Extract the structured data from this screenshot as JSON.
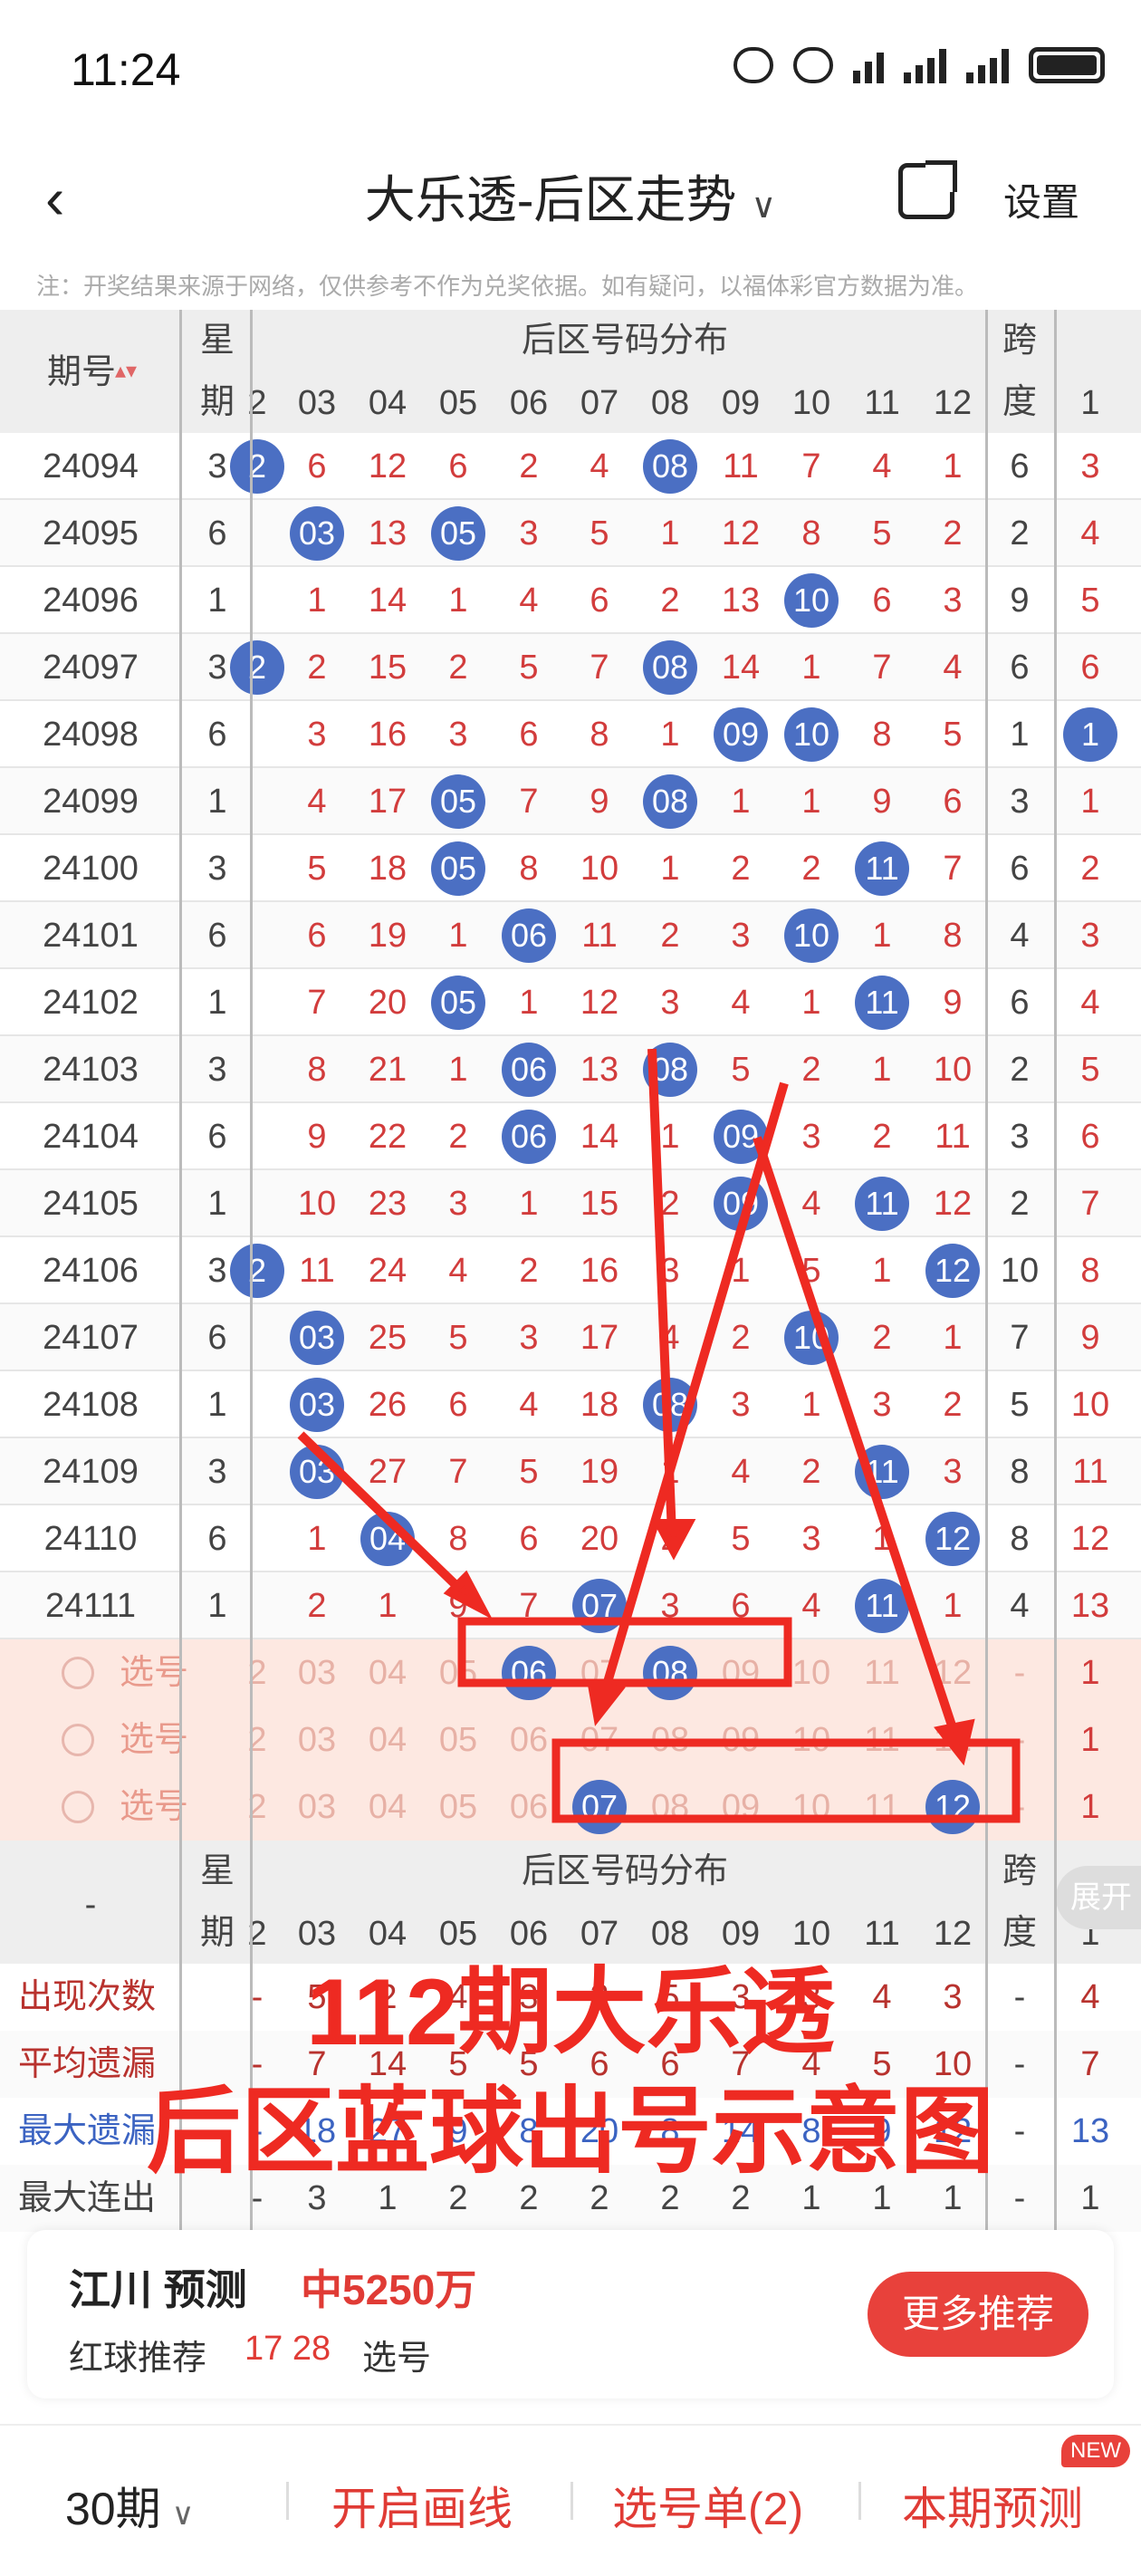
{
  "status": {
    "time": "11:24"
  },
  "header": {
    "title": "大乐透-后区走势",
    "settings": "设置"
  },
  "note": "注：开奖结果来源于网络，仅供参考不作为兑奖依据。如有疑问，以福体彩官方数据为准。",
  "table": {
    "header_issue": "期号",
    "header_week": [
      "星",
      "期"
    ],
    "header_dist": "后区号码分布",
    "header_span": [
      "跨",
      "度"
    ],
    "columns": [
      "2",
      "03",
      "04",
      "05",
      "06",
      "07",
      "08",
      "09",
      "10",
      "11",
      "12"
    ],
    "extra_col": "1",
    "rows": [
      {
        "issue": "24094",
        "week": "3",
        "cells": [
          "2",
          "6",
          "12",
          "6",
          "2",
          "4",
          "08",
          "11",
          "7",
          "4",
          "1"
        ],
        "balls": [
          0,
          6
        ],
        "span": "6",
        "extra": "3"
      },
      {
        "issue": "24095",
        "week": "6",
        "cells": [
          "",
          "03",
          "13",
          "05",
          "3",
          "5",
          "1",
          "12",
          "8",
          "5",
          "2"
        ],
        "balls": [
          1,
          3
        ],
        "span": "2",
        "extra": "4"
      },
      {
        "issue": "24096",
        "week": "1",
        "cells": [
          "",
          "1",
          "14",
          "1",
          "4",
          "6",
          "2",
          "13",
          "10",
          "6",
          "3"
        ],
        "balls": [
          8
        ],
        "span": "9",
        "extra": "5"
      },
      {
        "issue": "24097",
        "week": "3",
        "cells": [
          "2",
          "2",
          "15",
          "2",
          "5",
          "7",
          "08",
          "14",
          "1",
          "7",
          "4"
        ],
        "balls": [
          0,
          6
        ],
        "span": "6",
        "extra": "6"
      },
      {
        "issue": "24098",
        "week": "6",
        "cells": [
          "",
          "3",
          "16",
          "3",
          "6",
          "8",
          "1",
          "09",
          "10",
          "8",
          "5"
        ],
        "balls": [
          7,
          8
        ],
        "span": "1",
        "extra": "1",
        "extra_ball": true
      },
      {
        "issue": "24099",
        "week": "1",
        "cells": [
          "",
          "4",
          "17",
          "05",
          "7",
          "9",
          "08",
          "1",
          "1",
          "9",
          "6"
        ],
        "balls": [
          3,
          6
        ],
        "span": "3",
        "extra": "1"
      },
      {
        "issue": "24100",
        "week": "3",
        "cells": [
          "",
          "5",
          "18",
          "05",
          "8",
          "10",
          "1",
          "2",
          "2",
          "11",
          "7"
        ],
        "balls": [
          3,
          9
        ],
        "span": "6",
        "extra": "2"
      },
      {
        "issue": "24101",
        "week": "6",
        "cells": [
          "",
          "6",
          "19",
          "1",
          "06",
          "11",
          "2",
          "3",
          "10",
          "1",
          "8"
        ],
        "balls": [
          4,
          8
        ],
        "span": "4",
        "extra": "3"
      },
      {
        "issue": "24102",
        "week": "1",
        "cells": [
          "",
          "7",
          "20",
          "05",
          "1",
          "12",
          "3",
          "4",
          "1",
          "11",
          "9"
        ],
        "balls": [
          3,
          9
        ],
        "span": "6",
        "extra": "4"
      },
      {
        "issue": "24103",
        "week": "3",
        "cells": [
          "",
          "8",
          "21",
          "1",
          "06",
          "13",
          "08",
          "5",
          "2",
          "1",
          "10"
        ],
        "balls": [
          4,
          6
        ],
        "span": "2",
        "extra": "5"
      },
      {
        "issue": "24104",
        "week": "6",
        "cells": [
          "",
          "9",
          "22",
          "2",
          "06",
          "14",
          "1",
          "09",
          "3",
          "2",
          "11"
        ],
        "balls": [
          4,
          7
        ],
        "span": "3",
        "extra": "6"
      },
      {
        "issue": "24105",
        "week": "1",
        "cells": [
          "",
          "10",
          "23",
          "3",
          "1",
          "15",
          "2",
          "09",
          "4",
          "11",
          "12"
        ],
        "balls": [
          7,
          9
        ],
        "span": "2",
        "extra": "7"
      },
      {
        "issue": "24106",
        "week": "3",
        "cells": [
          "2",
          "11",
          "24",
          "4",
          "2",
          "16",
          "3",
          "1",
          "5",
          "1",
          "12"
        ],
        "balls": [
          0,
          10
        ],
        "span": "10",
        "extra": "8"
      },
      {
        "issue": "24107",
        "week": "6",
        "cells": [
          "",
          "03",
          "25",
          "5",
          "3",
          "17",
          "4",
          "2",
          "10",
          "2",
          "1"
        ],
        "balls": [
          1,
          8
        ],
        "span": "7",
        "extra": "9"
      },
      {
        "issue": "24108",
        "week": "1",
        "cells": [
          "",
          "03",
          "26",
          "6",
          "4",
          "18",
          "08",
          "3",
          "1",
          "3",
          "2"
        ],
        "balls": [
          1,
          6
        ],
        "span": "5",
        "extra": "10"
      },
      {
        "issue": "24109",
        "week": "3",
        "cells": [
          "",
          "03",
          "27",
          "7",
          "5",
          "19",
          "1",
          "4",
          "2",
          "11",
          "3"
        ],
        "balls": [
          1,
          9
        ],
        "span": "8",
        "extra": "11"
      },
      {
        "issue": "24110",
        "week": "6",
        "cells": [
          "",
          "1",
          "04",
          "8",
          "6",
          "20",
          "2",
          "5",
          "3",
          "1",
          "12"
        ],
        "balls": [
          2,
          10
        ],
        "span": "8",
        "extra": "12"
      },
      {
        "issue": "24111",
        "week": "1",
        "cells": [
          "",
          "2",
          "1",
          "9",
          "7",
          "07",
          "3",
          "6",
          "4",
          "11",
          "1"
        ],
        "balls": [
          5,
          9
        ],
        "span": "4",
        "extra": "13"
      }
    ],
    "select_rows": [
      {
        "label": "选号",
        "cells": [
          "2",
          "03",
          "04",
          "05",
          "06",
          "07",
          "08",
          "09",
          "10",
          "11",
          "12"
        ],
        "balls": [
          4,
          6
        ],
        "span": "-",
        "extra": "1"
      },
      {
        "label": "选号",
        "cells": [
          "2",
          "03",
          "04",
          "05",
          "06",
          "07",
          "08",
          "09",
          "10",
          "11",
          "12"
        ],
        "balls": [],
        "span": "-",
        "extra": "1"
      },
      {
        "label": "选号",
        "cells": [
          "2",
          "03",
          "04",
          "05",
          "06",
          "07",
          "08",
          "09",
          "10",
          "11",
          "12"
        ],
        "balls": [
          5,
          10
        ],
        "span": "-",
        "extra": "1"
      }
    ],
    "footer_dash": "-",
    "stats": [
      {
        "label": "出现次数",
        "color": "#b8322e",
        "cells": [
          "-",
          "5",
          "2",
          "4",
          "3",
          "2",
          "5",
          "3",
          "3",
          "4",
          "3"
        ],
        "span": "-",
        "extra": "4"
      },
      {
        "label": "平均遗漏",
        "color": "#b8322e",
        "cells": [
          "-",
          "7",
          "14",
          "5",
          "5",
          "6",
          "6",
          "7",
          "4",
          "5",
          "10"
        ],
        "span": "-",
        "extra": "7"
      },
      {
        "label": "最大遗漏",
        "color": "#3b63c2",
        "cells": [
          "-",
          "18",
          "27",
          "9",
          "8",
          "20",
          "8",
          "14",
          "8",
          "9",
          "12"
        ],
        "span": "-",
        "extra": "13"
      },
      {
        "label": "最大连出",
        "color": "#444444",
        "cells": [
          "-",
          "3",
          "1",
          "2",
          "2",
          "2",
          "2",
          "2",
          "1",
          "1",
          "1"
        ],
        "span": "-",
        "extra": "1"
      }
    ],
    "expand": "展开"
  },
  "overlay": {
    "line1": "112期大乐透",
    "line2": "后区蓝球出号示意图"
  },
  "card": {
    "name": "江川 预测",
    "win": "中5250万",
    "rec_label": "红球推荐",
    "rec_nums": "17 28",
    "sel_label": "选号",
    "more": "更多推荐"
  },
  "bottom": {
    "period": "30期",
    "draw": "开启画线",
    "sel_list": "选号单(2)",
    "predict": "本期预测",
    "new_badge": "NEW"
  }
}
